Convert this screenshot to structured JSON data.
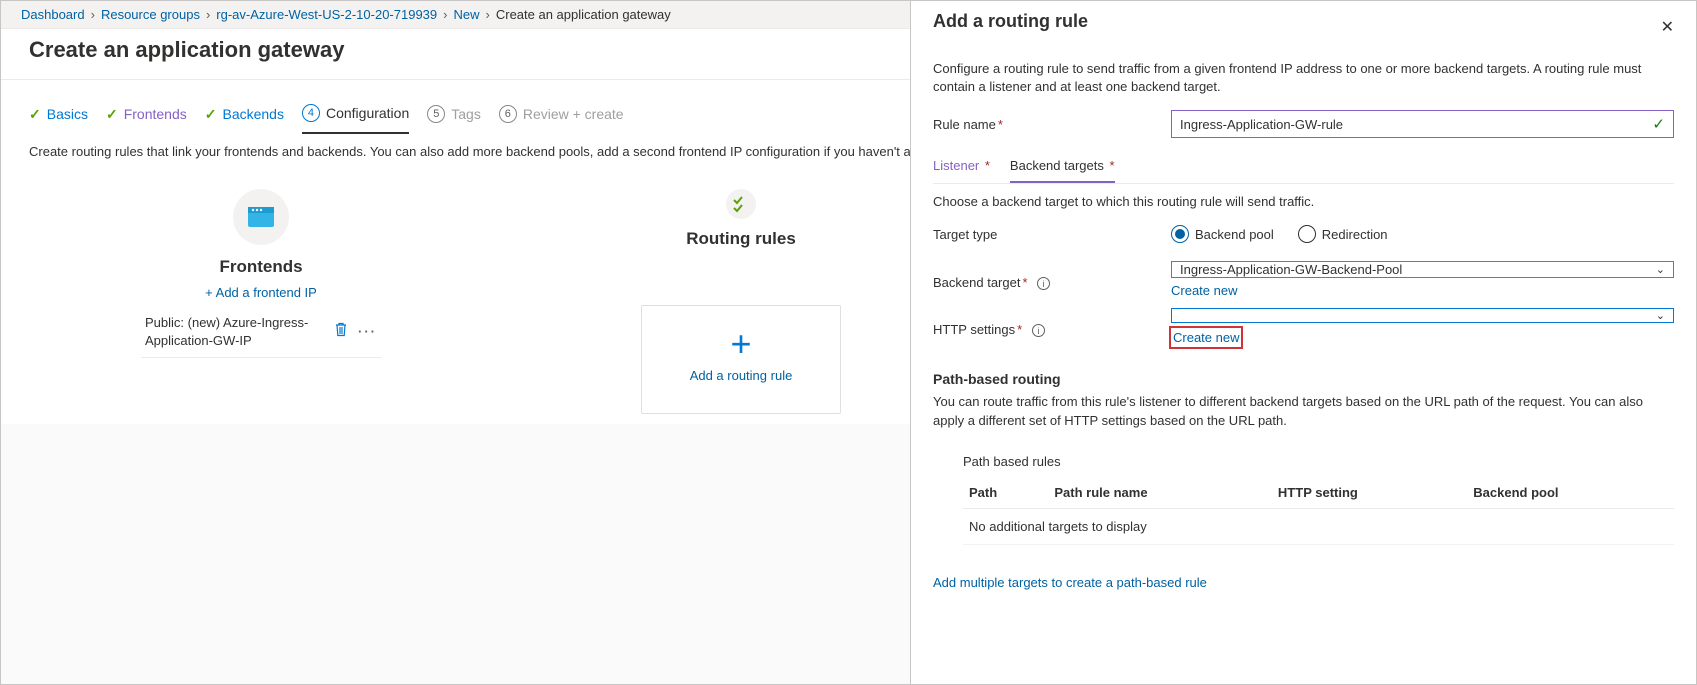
{
  "breadcrumb": {
    "items": [
      "Dashboard",
      "Resource groups",
      "rg-av-Azure-West-US-2-10-20-719939",
      "New"
    ],
    "current": "Create an application gateway"
  },
  "page": {
    "title": "Create an application gateway",
    "description": "Create routing rules that link your frontends and backends. You can also add more backend pools, add a second frontend IP configuration if you haven't already done so."
  },
  "wizard": {
    "steps": [
      {
        "label": "Basics",
        "state": "done"
      },
      {
        "label": "Frontends",
        "state": "done-active"
      },
      {
        "label": "Backends",
        "state": "done"
      },
      {
        "label": "Configuration",
        "state": "current",
        "num": "4"
      },
      {
        "label": "Tags",
        "state": "disabled",
        "num": "5"
      },
      {
        "label": "Review + create",
        "state": "disabled",
        "num": "6"
      }
    ]
  },
  "frontends": {
    "title": "Frontends",
    "add_link": "+ Add a frontend IP",
    "item_text": "Public: (new) Azure-Ingress-Application-GW-IP"
  },
  "routing": {
    "title": "Routing rules",
    "add_link": "Add a routing rule"
  },
  "panel": {
    "title": "Add a routing rule",
    "lead": "Configure a routing rule to send traffic from a given frontend IP address to one or more backend targets. A routing rule must contain a listener and at least one backend target.",
    "rule_name_label": "Rule name",
    "rule_name_value": "Ingress-Application-GW-rule",
    "tabs": {
      "listener": "Listener",
      "backend": "Backend targets"
    },
    "choose_text": "Choose a backend target to which this routing rule will send traffic.",
    "target_type_label": "Target type",
    "target_type_options": {
      "pool": "Backend pool",
      "redir": "Redirection"
    },
    "backend_target_label": "Backend target",
    "backend_target_value": "Ingress-Application-GW-Backend-Pool",
    "http_settings_label": "HTTP settings",
    "http_settings_value": "",
    "create_new": "Create new",
    "path_routing_title": "Path-based routing",
    "path_routing_desc": "You can route traffic from this rule's listener to different backend targets based on the URL path of the request. You can also apply a different set of HTTP settings based on the URL path.",
    "table": {
      "title": "Path based rules",
      "headers": [
        "Path",
        "Path rule name",
        "HTTP setting",
        "Backend pool"
      ],
      "empty": "No additional targets to display"
    },
    "add_multi": "Add multiple targets to create a path-based rule"
  }
}
